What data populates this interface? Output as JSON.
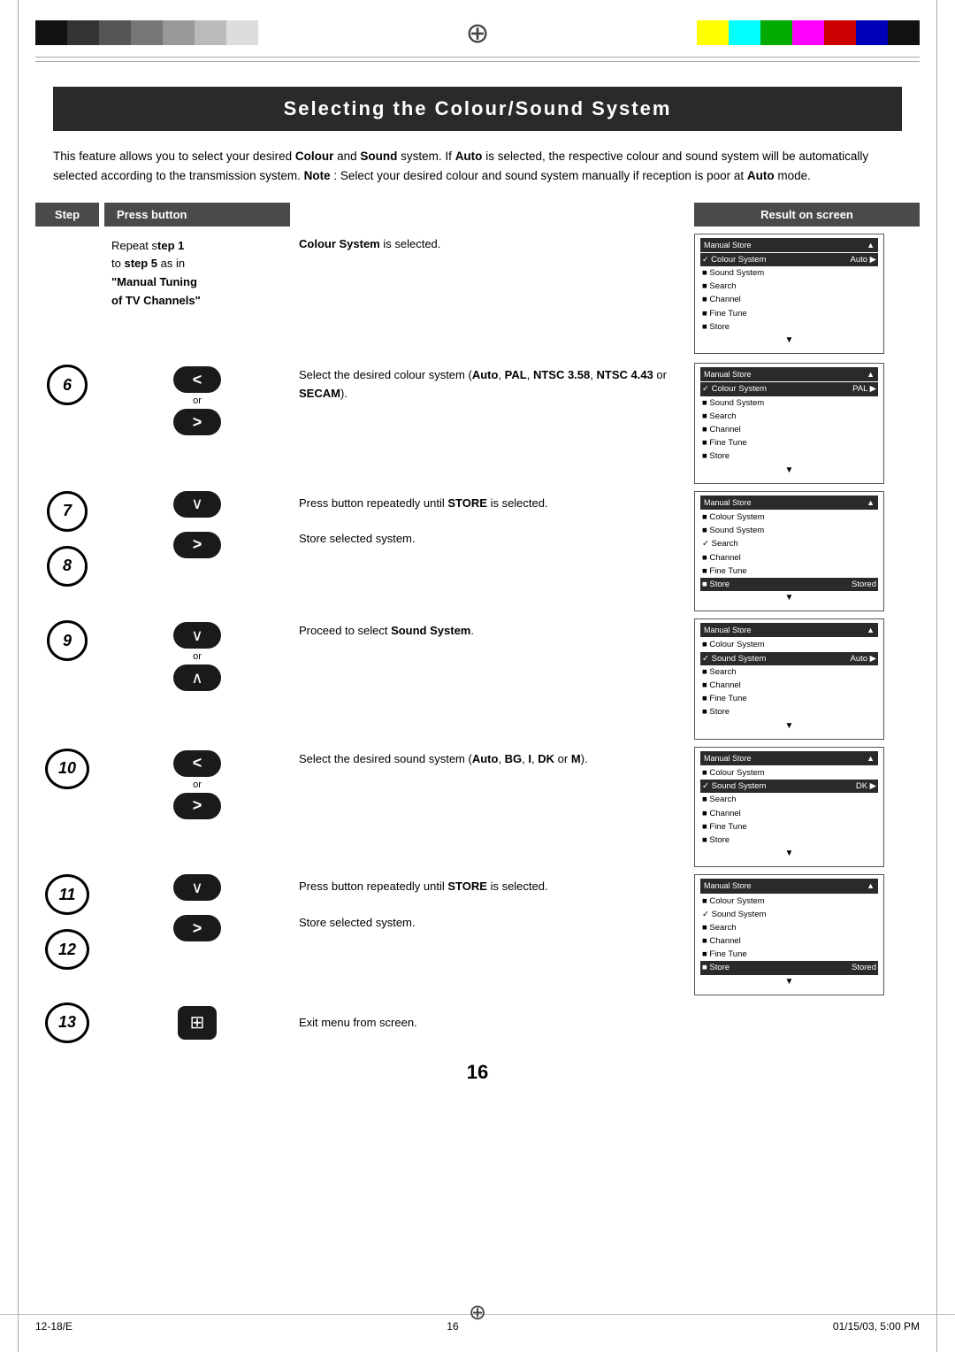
{
  "page": {
    "title": "Selecting the Colour/Sound System",
    "page_number": "16",
    "footer_left": "12-18/E",
    "footer_center": "16",
    "footer_right": "01/15/03, 5:00 PM"
  },
  "header": {
    "col_step": "Step",
    "col_press": "Press button",
    "col_result": "Result on screen"
  },
  "intro": {
    "text1": "This feature allows you to select your desired ",
    "bold1": "Colour",
    "text2": " and ",
    "bold2": "Sound",
    "text3": " system. If ",
    "bold3": "Auto",
    "text4": " is selected, the respective colour and sound system will be automatically selected according to the transmission system. ",
    "bold4": "Note",
    "text5": " : Select your desired colour and sound system manually if reception is poor at ",
    "bold5": "Auto",
    "text6": " mode."
  },
  "rows": [
    {
      "step": "",
      "button": "text",
      "desc_normal": "Repeat s",
      "desc_bold": "tep 1",
      "desc2": " to ",
      "desc2_bold": "step 5",
      "desc3": " as in ",
      "desc4_bold": "“Manual Tuning of TV Channels”",
      "result_label": "Colour System is selected.",
      "screen_title": "Manual Store",
      "screen_rows": [
        {
          "check": true,
          "label": "Colour System",
          "value": "Auto ►"
        },
        {
          "bullet": true,
          "label": "Sound System",
          "value": ""
        },
        {
          "bullet": true,
          "label": "Search",
          "value": ""
        },
        {
          "bullet": true,
          "label": "Channel",
          "value": ""
        },
        {
          "bullet": true,
          "label": "Fine Tune",
          "value": ""
        },
        {
          "bullet": true,
          "label": "Store",
          "value": ""
        }
      ]
    }
  ],
  "steps": [
    {
      "num": "6",
      "buttons": [
        {
          "symbol": "<"
        },
        {
          "symbol": ">"
        }
      ],
      "or": true,
      "desc": "Select the desired colour system (",
      "desc_bold1": "Auto",
      "desc2": ", ",
      "desc_bold2": "PAL",
      "desc3": ", ",
      "desc_bold3": "NTSC 3.58",
      "desc4": ", ",
      "desc_bold4": "NTSC 4.43",
      "desc5": " or ",
      "desc_bold5": "SECAM",
      "desc6": ").",
      "screen": {
        "title": "Manual Store",
        "rows": [
          {
            "check": true,
            "label": "Colour System",
            "value": "PAL ►",
            "highlighted": true
          },
          {
            "bullet": true,
            "label": "Sound System",
            "value": ""
          },
          {
            "bullet": true,
            "label": "Search",
            "value": ""
          },
          {
            "bullet": true,
            "label": "Channel",
            "value": ""
          },
          {
            "bullet": true,
            "label": "Fine Tune",
            "value": ""
          },
          {
            "bullet": true,
            "label": "Store",
            "value": ""
          }
        ]
      }
    },
    {
      "num": "7",
      "buttons": [
        {
          "symbol": "∨"
        }
      ],
      "or": false,
      "desc_pre": "Press button repeatedly until ",
      "desc_bold": "STORE",
      "desc_post": " is selected.",
      "screen": null
    },
    {
      "num": "8",
      "buttons": [
        {
          "symbol": ">"
        }
      ],
      "or": false,
      "desc": "Store selected system.",
      "screen": {
        "title": "Manual Store",
        "rows": [
          {
            "bullet": true,
            "label": "Colour System",
            "value": ""
          },
          {
            "bullet": true,
            "label": "Sound System",
            "value": ""
          },
          {
            "check": true,
            "label": "Search",
            "value": ""
          },
          {
            "bullet": true,
            "label": "Channel",
            "value": ""
          },
          {
            "bullet": true,
            "label": "Fine Tune",
            "value": ""
          },
          {
            "bullet": true,
            "label": "Store",
            "value": "Stored",
            "highlighted": true
          }
        ]
      }
    },
    {
      "num": "9",
      "buttons": [
        {
          "symbol": "∨"
        },
        {
          "symbol": "˄"
        }
      ],
      "or": true,
      "desc_pre": "Proceed to select ",
      "desc_bold": "Sound System",
      "desc_post": ".",
      "screen": {
        "title": "Manual Store",
        "rows": [
          {
            "bullet": true,
            "label": "Colour System",
            "value": ""
          },
          {
            "check": true,
            "label": "Sound System",
            "value": "Auto ►",
            "highlighted": true
          },
          {
            "bullet": true,
            "label": "Search",
            "value": ""
          },
          {
            "bullet": true,
            "label": "Channel",
            "value": ""
          },
          {
            "bullet": true,
            "label": "Fine Tune",
            "value": ""
          },
          {
            "bullet": true,
            "label": "Store",
            "value": ""
          }
        ]
      }
    },
    {
      "num": "10",
      "buttons": [
        {
          "symbol": "<"
        },
        {
          "symbol": ">"
        }
      ],
      "or": true,
      "desc_pre": "Select the desired sound system (",
      "desc_bold1": "Auto",
      "desc2": ", ",
      "desc_bold2": "BG",
      "desc3": ", ",
      "desc_bold3": "I",
      "desc4": ", ",
      "desc_bold4": "DK",
      "desc5": " or ",
      "desc_bold5": "M",
      "desc6": ").",
      "screen": {
        "title": "Manual Store",
        "rows": [
          {
            "bullet": true,
            "label": "Colour System",
            "value": ""
          },
          {
            "check": true,
            "label": "Sound System",
            "value": "DK ►",
            "highlighted": true
          },
          {
            "bullet": true,
            "label": "Search",
            "value": ""
          },
          {
            "bullet": true,
            "label": "Channel",
            "value": ""
          },
          {
            "bullet": true,
            "label": "Fine Tune",
            "value": ""
          },
          {
            "bullet": true,
            "label": "Store",
            "value": ""
          }
        ]
      }
    },
    {
      "num": "11",
      "buttons": [
        {
          "symbol": "∨"
        }
      ],
      "or": false,
      "desc_pre": "Press button repeatedly until ",
      "desc_bold": "STORE",
      "desc_post": " is selected.",
      "screen": null
    },
    {
      "num": "12",
      "buttons": [
        {
          "symbol": ">"
        }
      ],
      "or": false,
      "desc": "Store selected system.",
      "screen": {
        "title": "Manual Store",
        "rows": [
          {
            "bullet": true,
            "label": "Colour System",
            "value": ""
          },
          {
            "bullet": true,
            "label": "Sound System",
            "value": ""
          },
          {
            "check": true,
            "label": "Search",
            "value": ""
          },
          {
            "bullet": true,
            "label": "Channel",
            "value": ""
          },
          {
            "bullet": true,
            "label": "Fine Tune",
            "value": ""
          },
          {
            "bullet": true,
            "label": "Store",
            "value": "Stored",
            "highlighted": true
          }
        ]
      }
    },
    {
      "num": "13",
      "buttons": [
        {
          "symbol": "⧉"
        }
      ],
      "or": false,
      "desc": "Exit menu from screen.",
      "screen": null
    }
  ],
  "colors": {
    "title_bg": "#2a2a2a",
    "header_bg": "#4a4a4a",
    "screen_title_bg": "#2a2a2a",
    "btn_bg": "#1a1a1a"
  }
}
